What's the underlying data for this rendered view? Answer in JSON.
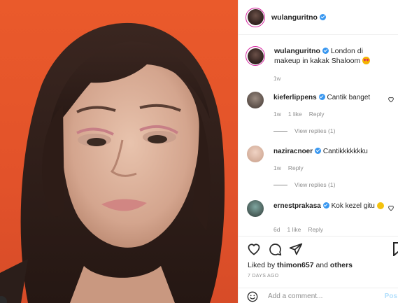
{
  "post": {
    "username": "wulanguritno",
    "caption_text": "London di makeup in kakak Shaloom",
    "caption_time": "1w"
  },
  "comments": [
    {
      "username": "kieferlippens",
      "text": "Cantik banget",
      "time": "1w",
      "likes": "1 like",
      "reply": "Reply",
      "view_replies": "View replies (1)"
    },
    {
      "username": "naziracnoer",
      "text": "Cantikkkkkkku",
      "time": "1w",
      "reply": "Reply",
      "view_replies": "View replies (1)"
    },
    {
      "username": "ernestprakasa",
      "text": "Kok kezel gitu",
      "time": "6d",
      "likes": "1 like",
      "reply": "Reply"
    }
  ],
  "actions": {
    "liked_prefix": "Liked by",
    "liked_user": "thimon657",
    "liked_and": "and",
    "liked_others": "others",
    "time_ago": "7 DAYS AGO"
  },
  "add_comment": {
    "placeholder": "Add a comment...",
    "post_label": "Pos"
  },
  "colors": {
    "photo_background": "#e85a2b",
    "verified_badge": "#3897f0",
    "post_button_disabled": "#b2dffc"
  }
}
